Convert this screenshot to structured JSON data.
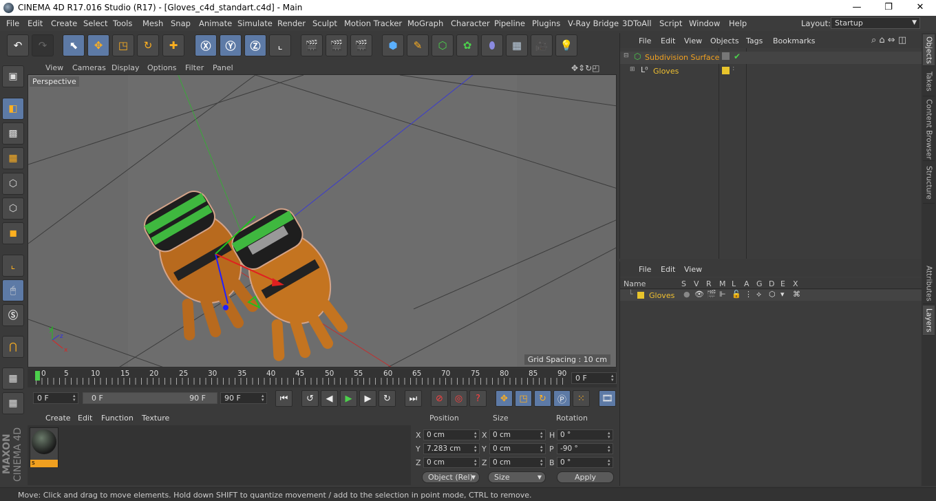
{
  "window": {
    "title": "CINEMA 4D R17.016 Studio (R17) - [Gloves_c4d_standart.c4d] - Main",
    "minimize": "—",
    "maximize": "❐",
    "close": "✕"
  },
  "menu": {
    "items": [
      "File",
      "Edit",
      "Create",
      "Select",
      "Tools",
      "Mesh",
      "Snap",
      "Animate",
      "Simulate",
      "Render",
      "Sculpt",
      "Motion Tracker",
      "MoGraph",
      "Character",
      "Pipeline",
      "Plugins",
      "V-Ray Bridge",
      "3DToAll",
      "Script",
      "Window",
      "Help"
    ],
    "layout_label": "Layout:",
    "layout_value": "Startup"
  },
  "viewport": {
    "menu": [
      "View",
      "Cameras",
      "Display",
      "Options",
      "Filter",
      "Panel"
    ],
    "camera_label": "Perspective",
    "grid_spacing": "Grid Spacing : 10 cm"
  },
  "timeline": {
    "ticks": [
      "0",
      "5",
      "10",
      "15",
      "20",
      "25",
      "30",
      "35",
      "40",
      "45",
      "50",
      "55",
      "60",
      "65",
      "70",
      "75",
      "80",
      "85",
      "90"
    ],
    "current_frame": "0 F",
    "start_field": "0 F",
    "range_start": "0 F",
    "range_end": "90 F",
    "end_field": "90 F"
  },
  "material_manager": {
    "menu": [
      "Create",
      "Edit",
      "Function",
      "Texture"
    ],
    "material_name": "s"
  },
  "coordinates": {
    "headers": {
      "position": "Position",
      "size": "Size",
      "rotation": "Rotation"
    },
    "rows": [
      {
        "axis": "X",
        "pos": "0 cm",
        "size_axis": "X",
        "size": "0 cm",
        "rot_axis": "H",
        "rot": "0 °"
      },
      {
        "axis": "Y",
        "pos": "7.283 cm",
        "size_axis": "Y",
        "size": "0 cm",
        "rot_axis": "P",
        "rot": "-90 °"
      },
      {
        "axis": "Z",
        "pos": "0 cm",
        "size_axis": "Z",
        "size": "0 cm",
        "rot_axis": "B",
        "rot": "0 °"
      }
    ],
    "mode": "Object (Rel)",
    "size_mode": "Size",
    "apply": "Apply"
  },
  "object_manager": {
    "menu": [
      "File",
      "Edit",
      "View",
      "Objects",
      "Tags",
      "Bookmarks"
    ],
    "objects": [
      {
        "name": "Subdivision Surface",
        "color": "#f0a020"
      },
      {
        "name": "Gloves",
        "color": "#f0c030"
      }
    ]
  },
  "layer_manager": {
    "menu": [
      "File",
      "Edit",
      "View"
    ],
    "columns": [
      "Name",
      "S",
      "V",
      "R",
      "M",
      "L",
      "A",
      "G",
      "D",
      "E",
      "X"
    ],
    "layers": [
      {
        "name": "Gloves",
        "color": "#e8c42c"
      }
    ]
  },
  "right_tabs": [
    "Objects",
    "Takes",
    "Content Browser",
    "Structure",
    "Attributes",
    "Layers"
  ],
  "status": "Move: Click and drag to move elements. Hold down SHIFT to quantize movement / add to the selection in point mode, CTRL to remove.",
  "brand": {
    "line1": "MAXON",
    "line2": "CINEMA 4D"
  }
}
